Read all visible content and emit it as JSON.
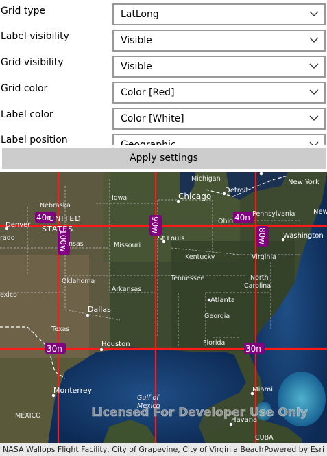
{
  "settings": {
    "rows": [
      {
        "label": "Grid type",
        "value": "LatLong"
      },
      {
        "label": "Label visibility",
        "value": "Visible"
      },
      {
        "label": "Grid visibility",
        "value": "Visible"
      },
      {
        "label": "Grid color",
        "value": "Color [Red]"
      },
      {
        "label": "Label color",
        "value": "Color [White]"
      },
      {
        "label": "Label position",
        "value": "Geographic"
      }
    ],
    "apply_label": "Apply settings"
  },
  "map": {
    "grid_color": "#ff1a1a",
    "label_bg": "#800080",
    "grid_labels": {
      "lat40": "40n",
      "lat30": "30n",
      "lon100": "100w",
      "lon90": "90w",
      "lon80": "80w"
    },
    "places": {
      "michigan": "Michigan",
      "detroit": "Detroit",
      "new_york": "New York",
      "iowa": "Iowa",
      "chicago": "Chicago",
      "pennsylvania": "Pennsylvania",
      "nebraska": "Nebraska",
      "denver": "Denver",
      "united_states_1": "UNITED",
      "united_states_2": "STATES",
      "ohio": "Ohio",
      "washington": "Washington",
      "nsas": "nsas",
      "missouri": "Missouri",
      "st_louis": "St Louis",
      "kentucky": "Kentucky",
      "virginia": "Virginia",
      "rado": "rado",
      "oklahoma": "Oklahoma",
      "tennessee": "Tennessee",
      "north_carolina_1": "North",
      "north_carolina_2": "Carolina",
      "exico": "exico",
      "arkansas": "Arkansas",
      "atlanta": "Atlanta",
      "dallas": "Dallas",
      "georgia": "Georgia",
      "texas": "Texas",
      "florida": "Florida",
      "houston": "Houston",
      "monterrey": "Monterrey",
      "gulf_1": "Gulf of",
      "gulf_2": "Mexico",
      "miami": "Miami",
      "mexico": "MÉXICO",
      "havana": "Havana",
      "cuba": "CUBA",
      "new": "New"
    },
    "watermark": "Licensed For Developer Use Only",
    "attribution": "NASA Wallops Flight Facility, City of Grapevine, City of Virginia Beach,...",
    "powered_by": "Powered by Esri"
  }
}
